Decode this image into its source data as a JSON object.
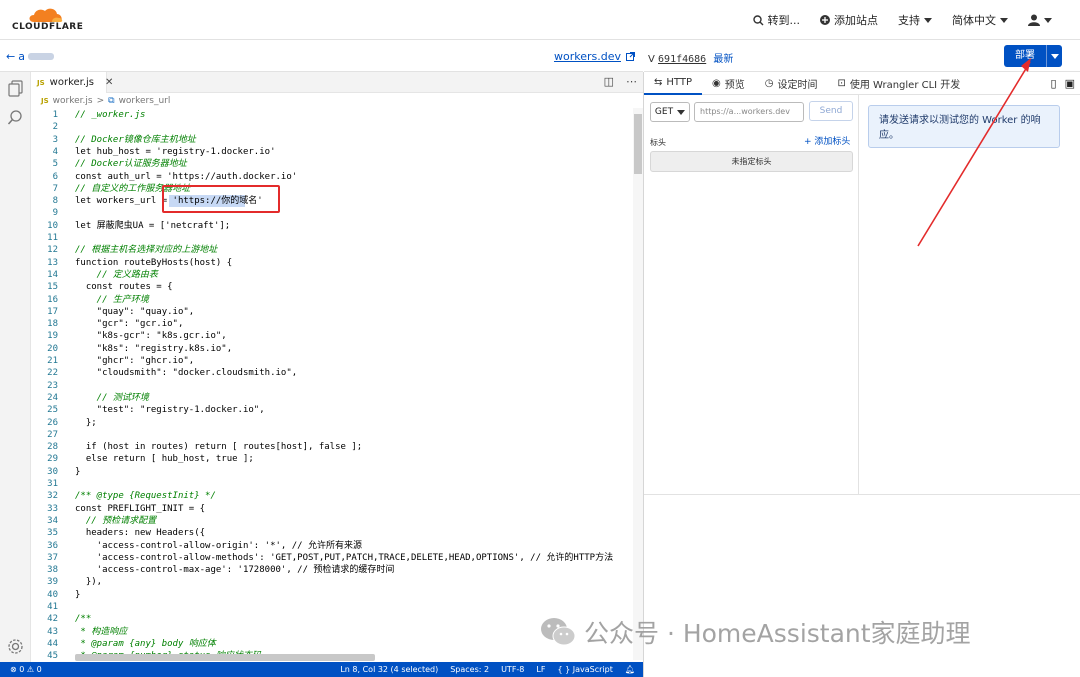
{
  "header": {
    "logo_text": "CLOUDFLARE",
    "goto": "转到...",
    "add_site": "添加站点",
    "support": "支持",
    "language": "简体中文",
    "user_icon": "user-icon"
  },
  "subheader": {
    "back_label": "a",
    "workers_dev": "workers.dev",
    "version_prefix": "V",
    "version_id": "691f4686",
    "latest": "最新",
    "deploy": "部署"
  },
  "editor": {
    "tab_badge": "JS",
    "tab_name": "worker.js",
    "breadcrumb_file": "worker.js",
    "breadcrumb_sep": ">",
    "breadcrumb_symbol": "workers_url",
    "lines": [
      {
        "n": "1",
        "text": "// _worker.js"
      },
      {
        "n": "2",
        "text": ""
      },
      {
        "n": "3",
        "text": "// Docker镜像仓库主机地址"
      },
      {
        "n": "4",
        "text": "let hub_host = 'registry-1.docker.io'"
      },
      {
        "n": "5",
        "text": "// Docker认证服务器地址"
      },
      {
        "n": "6",
        "text": "const auth_url = 'https://auth.docker.io'"
      },
      {
        "n": "7",
        "text": "// 自定义的工作服务器地址"
      },
      {
        "n": "8",
        "text": "let workers_url = 'https://你的域名'"
      },
      {
        "n": "9",
        "text": ""
      },
      {
        "n": "10",
        "text": "let 屏蔽爬虫UA = ['netcraft'];"
      },
      {
        "n": "11",
        "text": ""
      },
      {
        "n": "12",
        "text": "// 根据主机名选择对应的上游地址"
      },
      {
        "n": "13",
        "text": "function routeByHosts(host) {"
      },
      {
        "n": "14",
        "text": "    // 定义路由表"
      },
      {
        "n": "15",
        "text": "  const routes = {"
      },
      {
        "n": "16",
        "text": "    // 生产环境"
      },
      {
        "n": "17",
        "text": "    \"quay\": \"quay.io\","
      },
      {
        "n": "18",
        "text": "    \"gcr\": \"gcr.io\","
      },
      {
        "n": "19",
        "text": "    \"k8s-gcr\": \"k8s.gcr.io\","
      },
      {
        "n": "20",
        "text": "    \"k8s\": \"registry.k8s.io\","
      },
      {
        "n": "21",
        "text": "    \"ghcr\": \"ghcr.io\","
      },
      {
        "n": "22",
        "text": "    \"cloudsmith\": \"docker.cloudsmith.io\","
      },
      {
        "n": "23",
        "text": ""
      },
      {
        "n": "24",
        "text": "    // 测试环境"
      },
      {
        "n": "25",
        "text": "    \"test\": \"registry-1.docker.io\","
      },
      {
        "n": "26",
        "text": "  };"
      },
      {
        "n": "27",
        "text": ""
      },
      {
        "n": "28",
        "text": "  if (host in routes) return [ routes[host], false ];"
      },
      {
        "n": "29",
        "text": "  else return [ hub_host, true ];"
      },
      {
        "n": "30",
        "text": "}"
      },
      {
        "n": "31",
        "text": ""
      },
      {
        "n": "32",
        "text": "/** @type {RequestInit} */"
      },
      {
        "n": "33",
        "text": "const PREFLIGHT_INIT = {"
      },
      {
        "n": "34",
        "text": "  // 预检请求配置"
      },
      {
        "n": "35",
        "text": "  headers: new Headers({"
      },
      {
        "n": "36",
        "text": "    'access-control-allow-origin': '*', // 允许所有来源"
      },
      {
        "n": "37",
        "text": "    'access-control-allow-methods': 'GET,POST,PUT,PATCH,TRACE,DELETE,HEAD,OPTIONS', // 允许的HTTP方法"
      },
      {
        "n": "38",
        "text": "    'access-control-max-age': '1728000', // 预检请求的缓存时间"
      },
      {
        "n": "39",
        "text": "  }),"
      },
      {
        "n": "40",
        "text": "}"
      },
      {
        "n": "41",
        "text": ""
      },
      {
        "n": "42",
        "text": "/**"
      },
      {
        "n": "43",
        "text": " * 构造响应"
      },
      {
        "n": "44",
        "text": " * @param {any} body 响应体"
      },
      {
        "n": "45",
        "text": " * @param {number} status 响应状态码"
      }
    ]
  },
  "statusbar": {
    "problems": "⊗ 0 ⚠ 0",
    "position": "Ln 8, Col 32 (4 selected)",
    "spaces": "Spaces: 2",
    "encoding": "UTF-8",
    "eol": "LF",
    "language": "{ } JavaScript"
  },
  "right": {
    "tabs": [
      "HTTP",
      "预览",
      "设定时间",
      "使用 Wrangler CLI 开发"
    ],
    "method": "GET",
    "url_value": "https://a...workers.dev",
    "send": "Send",
    "headers_label": "标头",
    "add_header": "+ 添加标头",
    "no_headers": "未指定标头",
    "hint": "请发送请求以测试您的 Worker 的响应。"
  },
  "watermark": "公众号 · HomeAssistant家庭助理",
  "colors": {
    "accent": "#0051c3",
    "annotation": "#e32b2b",
    "cloudflare_orange": "#f38020"
  }
}
